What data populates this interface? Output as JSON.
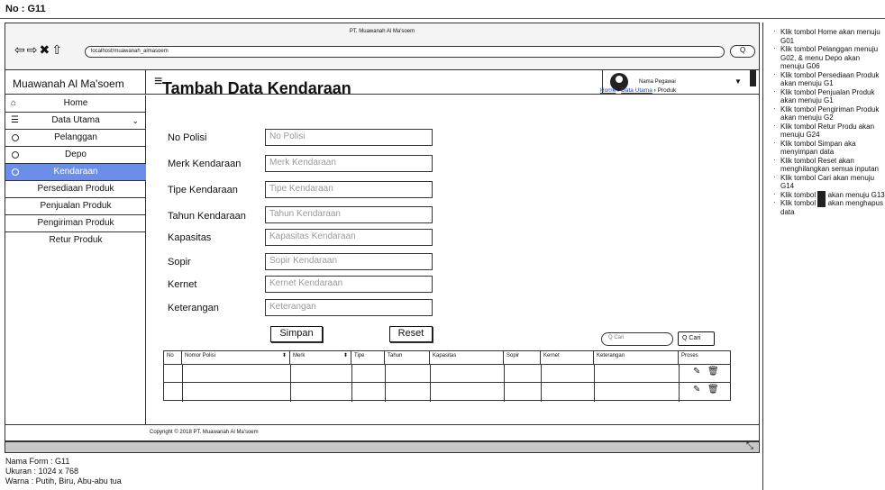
{
  "header": {
    "form_code": "No : G11"
  },
  "browser": {
    "title": "PT. Muawanah Al Ma'soem",
    "url": "localhost/muawanah_almasoem",
    "search_label": "Q"
  },
  "app": {
    "brand": "Muawanah Al Ma'soem",
    "user_name": "Nama Pegawai"
  },
  "sidebar": {
    "items": [
      {
        "label": "Home",
        "icon": "home-icon"
      },
      {
        "label": "Data Utama",
        "icon": "database-icon"
      },
      {
        "label": "Pelanggan"
      },
      {
        "label": "Depo"
      },
      {
        "label": "Kendaraan",
        "active": true
      },
      {
        "label": "Persediaan Produk"
      },
      {
        "label": "Penjualan Produk"
      },
      {
        "label": "Pengiriman Produk"
      },
      {
        "label": "Retur Produk"
      }
    ]
  },
  "page": {
    "title": "Tambah Data Kendaraan",
    "breadcrumb": [
      "Home",
      "Data Utama",
      "Produk"
    ]
  },
  "form": {
    "fields": [
      {
        "label": "No Polisi",
        "placeholder": "No Polisi"
      },
      {
        "label": "Merk Kendaraan",
        "placeholder": "Merk Kendaraan"
      },
      {
        "label": "Tipe Kendaraan",
        "placeholder": "Tipe Kendaraan"
      },
      {
        "label": "Tahun Kendaraan",
        "placeholder": "Tahun Kendaraan"
      },
      {
        "label": "Kapasitas",
        "placeholder": "Kapasitas Kendaraan"
      },
      {
        "label": "Sopir",
        "placeholder": "Sopir Kendaraan"
      },
      {
        "label": "Kernet",
        "placeholder": "Kernet Kendaraan"
      },
      {
        "label": "Keterangan",
        "placeholder": "Keterangan"
      }
    ],
    "save_label": "Simpan",
    "reset_label": "Reset"
  },
  "search": {
    "placeholder": "Q Cari",
    "button_label": "Q Cari"
  },
  "table": {
    "headers": [
      "No",
      "Nomor Polisi",
      "Merk",
      "Tipe",
      "Tahun",
      "Kapasitas",
      "Sopir",
      "Kernet",
      "Keterangan",
      "Proses"
    ]
  },
  "footer": {
    "copyright": "Copyright © 2018 PT. Muawanah Al Ma'soem"
  },
  "info": {
    "form_name": "Nama Form : G11",
    "size": "Ukuran : 1024 x 768",
    "colors": "Warna : Putih, Biru, Abu-abu tua"
  },
  "notes": [
    "Klik tombol Home akan menuju G01",
    "Klik tombol Pelanggan menuju G02, & menu Depo akan menuju G06",
    "Klik tombol Persediaan Produk akan menuju G1",
    "Klik tombol Penjualan Produk akan menuju G1",
    "Klik tombol Pengiriman Produk akan menuju G2",
    "Klik tombol Retur Produ akan menuju G24",
    "Klik tombol Simpan aka menyimpan data",
    "Klik tombol Reset akan menghilangkan semua inputan",
    "Klik tombol Cari akan menuju G14"
  ],
  "notes_icon": [
    {
      "pre": "Klik tombol",
      "post": "akan menuju G13",
      "icon": "edit-icon"
    },
    {
      "pre": "Klik tombol",
      "post": "akan menghapus data",
      "icon": "trash-icon"
    }
  ],
  "colors": {
    "accent": "#6b8fe8",
    "statusbar": "#c8c8c8"
  }
}
